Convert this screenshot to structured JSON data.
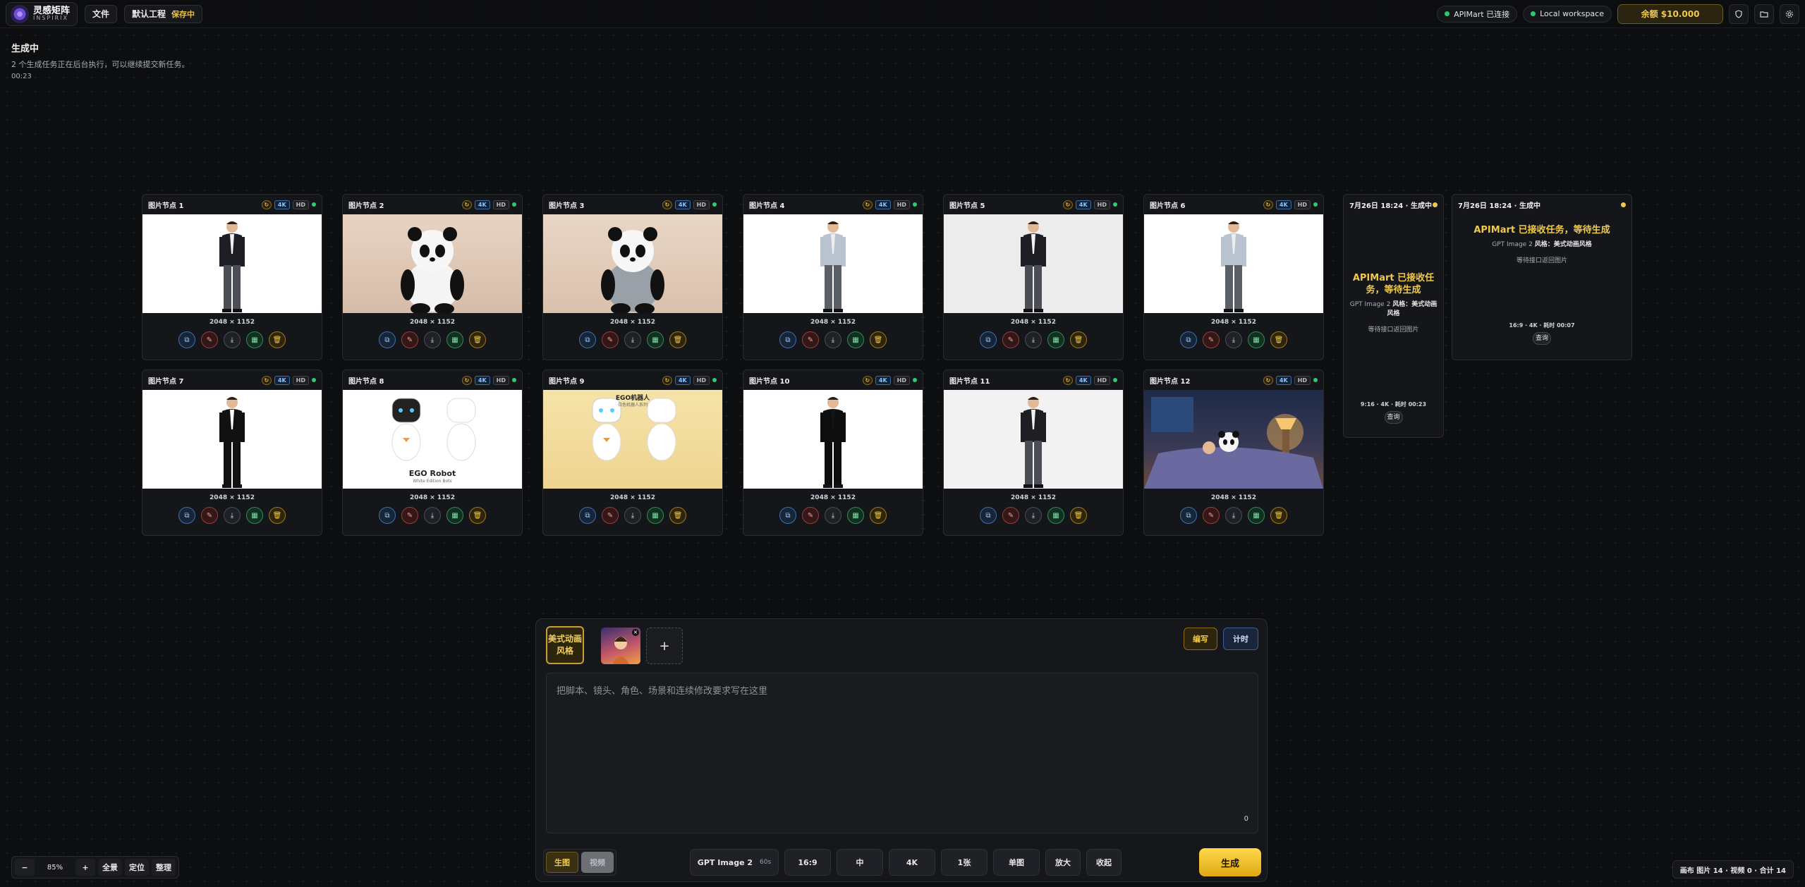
{
  "topbar": {
    "logo_cn": "灵感矩阵",
    "logo_en": "INSPIRIX",
    "file_label": "文件",
    "project_label": "默认工程",
    "saving_label": "保存中",
    "api_status": "APIMart 已连接",
    "workspace": "Local workspace",
    "balance": "余额 $10.000"
  },
  "status": {
    "title": "生成中",
    "message": "2 个生成任务正在后台执行，可以继续提交新任务。",
    "elapsed": "00:23"
  },
  "chip_labels": {
    "res": "4K",
    "hd": "HD"
  },
  "cards": [
    {
      "title": "图片节点 1",
      "dims": "2048 × 1152"
    },
    {
      "title": "图片节点 2",
      "dims": "2048 × 1152"
    },
    {
      "title": "图片节点 3",
      "dims": "2048 × 1152"
    },
    {
      "title": "图片节点 4",
      "dims": "2048 × 1152"
    },
    {
      "title": "图片节点 5",
      "dims": "2048 × 1152"
    },
    {
      "title": "图片节点 6",
      "dims": "2048 × 1152"
    },
    {
      "title": "图片节点 7",
      "dims": "2048 × 1152"
    },
    {
      "title": "图片节点 8",
      "dims": "2048 × 1152",
      "image_title": "EGO Robot",
      "image_sub": "White Edition Bots"
    },
    {
      "title": "图片节点 9",
      "dims": "2048 × 1152",
      "image_title": "EGO机器人",
      "image_sub": "白色机器人系列"
    },
    {
      "title": "图片节点 10",
      "dims": "2048 × 1152"
    },
    {
      "title": "图片节点 11",
      "dims": "2048 × 1152"
    },
    {
      "title": "图片节点 12",
      "dims": "2048 × 1152"
    }
  ],
  "pending": [
    {
      "header": "7月26日 18:24 · 生成中",
      "title": "APIMart 已接收任务，等待生成",
      "model": "GPT Image 2",
      "style_label": "风格：",
      "style": "美式动画风格",
      "wait": "等待接口返回图片",
      "meta": "9:16 · 4K · 耗时 00:23",
      "query": "查询"
    },
    {
      "header": "7月26日 18:24 · 生成中",
      "title": "APIMart 已接收任务，等待生成",
      "model": "GPT Image 2",
      "style_label": "风格：",
      "style": "美式动画风格",
      "wait": "等待接口返回图片",
      "meta": "16:9 · 4K · 耗时 00:07",
      "query": "查询"
    }
  ],
  "composer": {
    "style_tag": "美式动画风格",
    "thumb_label": "参考图",
    "write_label": "编写",
    "plan_label": "计时",
    "placeholder": "把脚本、镜头、角色、场景和连续修改要求写在这里",
    "char_count": "0",
    "mode_image": "生图",
    "mode_video": "视频",
    "model": "GPT Image 2",
    "model_time": "60s",
    "ratio": "16:9",
    "quality": "中",
    "resolution": "4K",
    "count": "1张",
    "layout": "单图",
    "upscale": "放大",
    "collapse": "收起",
    "generate": "生成"
  },
  "zoom": {
    "minus": "−",
    "value": "85%",
    "plus": "+",
    "fit": "全景",
    "locate": "定位",
    "arrange": "整理"
  },
  "footer": {
    "summary": "画布 图片 14 · 视频 0 · 合计 14"
  },
  "colors": {
    "accent": "#f0c94c",
    "ok": "#2ecc71",
    "bg": "#0d0e10"
  },
  "icons": [
    "copy-icon",
    "edit-icon",
    "download-icon",
    "grid-icon",
    "trash-icon",
    "refresh-icon",
    "shield-icon",
    "folder-icon",
    "gear-icon"
  ]
}
